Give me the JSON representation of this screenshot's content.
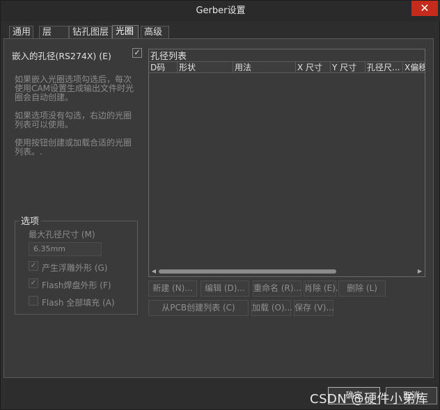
{
  "window": {
    "title": "Gerber设置",
    "close_label": "✕"
  },
  "tabs": [
    {
      "label": "通用",
      "active": false
    },
    {
      "label": "层",
      "active": false
    },
    {
      "label": "钻孔图层",
      "active": false
    },
    {
      "label": "光圈",
      "active": true
    },
    {
      "label": "高级",
      "active": false
    }
  ],
  "left": {
    "embed_label": "嵌入的孔径(RS274X) (E)",
    "embed_checked": true,
    "paragraphs": [
      "如果嵌入光圈选项勾选后，每次使用CAM设置生成输出文件时光圈会自动创建。",
      "如果选项没有勾选，右边的光圈列表可以使用。",
      "使用按钮创建或加载合适的光圈列表。."
    ],
    "options": {
      "legend": "选项",
      "max_label": "最大孔径尺寸 (M)",
      "max_value": "6.35mm",
      "checks": [
        {
          "label": "产生浮雕外形 (G)",
          "checked": true
        },
        {
          "label": "Flash焊盘外形 (F)",
          "checked": true
        },
        {
          "label": "Flash 全部填充 (A)",
          "checked": false
        }
      ]
    }
  },
  "list": {
    "title": "孔径列表",
    "columns": [
      "D码",
      "形状",
      "用法",
      "X 尺寸",
      "Y 尺寸",
      "孔径尺...",
      "X偏移"
    ]
  },
  "buttons": {
    "new": "新建 (N)...",
    "edit": "编辑 (D)...",
    "rename": "重命名 (R)...",
    "delete_dup": "肖除 (E).",
    "delete": "删除 (L)",
    "from_pcb": "从PCB创建列表 (C)",
    "load": "加载 (O)...",
    "save": "保存 (V)..."
  },
  "footer": {
    "ok": "确定",
    "cancel": "取消"
  },
  "watermark": "CSDN @硬件小弟库"
}
